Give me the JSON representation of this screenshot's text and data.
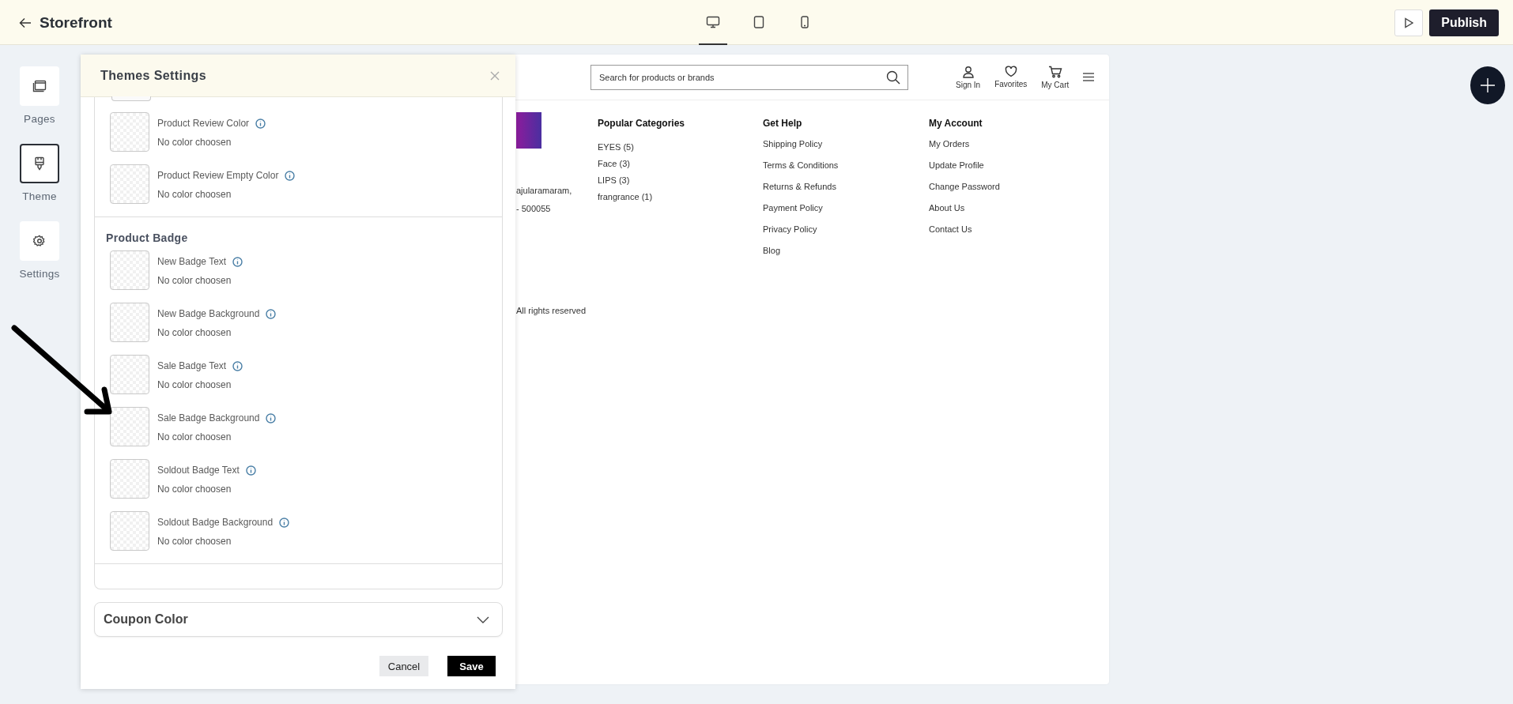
{
  "topbar": {
    "title": "Storefront",
    "devices": [
      {
        "kind": "desktop",
        "selected": true
      },
      {
        "kind": "tablet",
        "selected": false
      },
      {
        "kind": "mobile",
        "selected": false
      }
    ],
    "publish": "Publish"
  },
  "sidebar": {
    "items": [
      {
        "kind": "pages",
        "label": "Pages",
        "selected": false
      },
      {
        "kind": "theme",
        "label": "Theme",
        "selected": true
      },
      {
        "kind": "settings",
        "label": "Settings",
        "selected": false
      }
    ]
  },
  "panel": {
    "title": "Themes Settings",
    "groups": [
      {
        "rows": [
          {
            "label": "Product Review Color",
            "value": "No color choosen"
          },
          {
            "label": "Product Review Empty Color",
            "value": "No color choosen"
          }
        ]
      },
      {
        "heading": "Product Badge",
        "rows": [
          {
            "label": "New Badge Text",
            "value": "No color choosen"
          },
          {
            "label": "New Badge Background",
            "value": "No color choosen"
          },
          {
            "label": "Sale Badge Text",
            "value": "No color choosen"
          },
          {
            "label": "Sale Badge Background",
            "value": "No color choosen"
          },
          {
            "label": "Soldout Badge Text",
            "value": "No color choosen"
          },
          {
            "label": "Soldout Badge Background",
            "value": "No color choosen"
          }
        ]
      }
    ],
    "accordions": [
      {
        "title": "Coupon Color",
        "expanded": false
      }
    ],
    "cancel": "Cancel",
    "save": "Save"
  },
  "preview": {
    "search": {
      "placeholder": "Search for products or brands"
    },
    "header_links": [
      {
        "kind": "user",
        "label": "Sign In"
      },
      {
        "kind": "heart",
        "label": "Favorites"
      },
      {
        "kind": "cart",
        "label": "My Cart"
      }
    ],
    "footer": {
      "address_lines": [
        "ajularamaram,",
        "- 500055"
      ],
      "copyright": "All rights reserved",
      "columns": [
        {
          "heading": "Popular Categories",
          "links": [
            "EYES (5)",
            "Face (3)",
            "LIPS (3)",
            "frangrance (1)"
          ]
        },
        {
          "heading": "Get Help",
          "links": [
            "Shipping Policy",
            "Terms & Conditions",
            "Returns & Refunds",
            "Payment Policy",
            "Privacy Policy",
            "Blog"
          ]
        },
        {
          "heading": "My Account",
          "links": [
            "My Orders",
            "Update Profile",
            "Change Password",
            "About Us",
            "Contact Us"
          ]
        }
      ]
    }
  }
}
